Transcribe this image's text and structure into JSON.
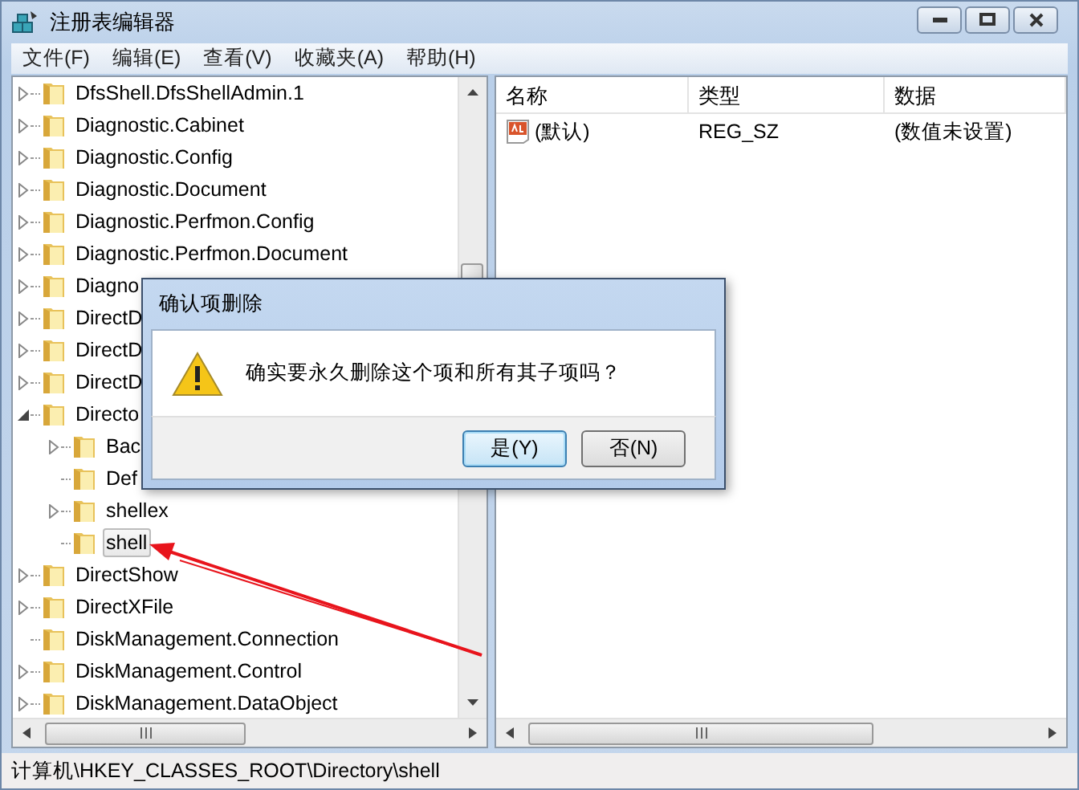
{
  "window": {
    "title": "注册表编辑器"
  },
  "menu": [
    "文件(F)",
    "编辑(E)",
    "查看(V)",
    "收藏夹(A)",
    "帮助(H)"
  ],
  "tree": [
    {
      "label": "DfsShell.DfsShellAdmin.1",
      "has_children": true,
      "expanded": false,
      "selected": false
    },
    {
      "label": "Diagnostic.Cabinet",
      "has_children": true,
      "expanded": false,
      "selected": false
    },
    {
      "label": "Diagnostic.Config",
      "has_children": true,
      "expanded": false,
      "selected": false
    },
    {
      "label": "Diagnostic.Document",
      "has_children": true,
      "expanded": false,
      "selected": false
    },
    {
      "label": "Diagnostic.Perfmon.Config",
      "has_children": true,
      "expanded": false,
      "selected": false
    },
    {
      "label": "Diagnostic.Perfmon.Document",
      "has_children": true,
      "expanded": false,
      "selected": false
    },
    {
      "label": "Diagno",
      "has_children": true,
      "expanded": false,
      "selected": false
    },
    {
      "label": "DirectD",
      "has_children": true,
      "expanded": false,
      "selected": false
    },
    {
      "label": "DirectD",
      "has_children": true,
      "expanded": false,
      "selected": false
    },
    {
      "label": "DirectD",
      "has_children": true,
      "expanded": false,
      "selected": false
    },
    {
      "label": "Directo",
      "has_children": true,
      "expanded": true,
      "selected": false,
      "children": [
        {
          "label": "Bac",
          "has_children": true,
          "expanded": false,
          "selected": false
        },
        {
          "label": "Def",
          "has_children": false,
          "selected": false
        },
        {
          "label": "shellex",
          "has_children": true,
          "expanded": false,
          "selected": false
        },
        {
          "label": "shell",
          "has_children": false,
          "selected": true
        }
      ]
    },
    {
      "label": "DirectShow",
      "has_children": true,
      "expanded": false,
      "selected": false
    },
    {
      "label": "DirectXFile",
      "has_children": true,
      "expanded": false,
      "selected": false
    },
    {
      "label": "DiskManagement.Connection",
      "has_children": false,
      "selected": false
    },
    {
      "label": "DiskManagement.Control",
      "has_children": true,
      "expanded": false,
      "selected": false
    },
    {
      "label": "DiskManagement.DataObject",
      "has_children": true,
      "expanded": false,
      "selected": false
    }
  ],
  "list": {
    "columns": [
      "名称",
      "类型",
      "数据"
    ],
    "rows": [
      {
        "name": "(默认)",
        "type": "REG_SZ",
        "data": "(数值未设置)"
      }
    ]
  },
  "dialog": {
    "title": "确认项删除",
    "message": "确实要永久删除这个项和所有其子项吗？",
    "buttons": [
      {
        "label": "是(Y)",
        "default": true
      },
      {
        "label": "否(N)",
        "default": false
      }
    ]
  },
  "status_bar": "计算机\\HKEY_CLASSES_ROOT\\Directory\\shell"
}
